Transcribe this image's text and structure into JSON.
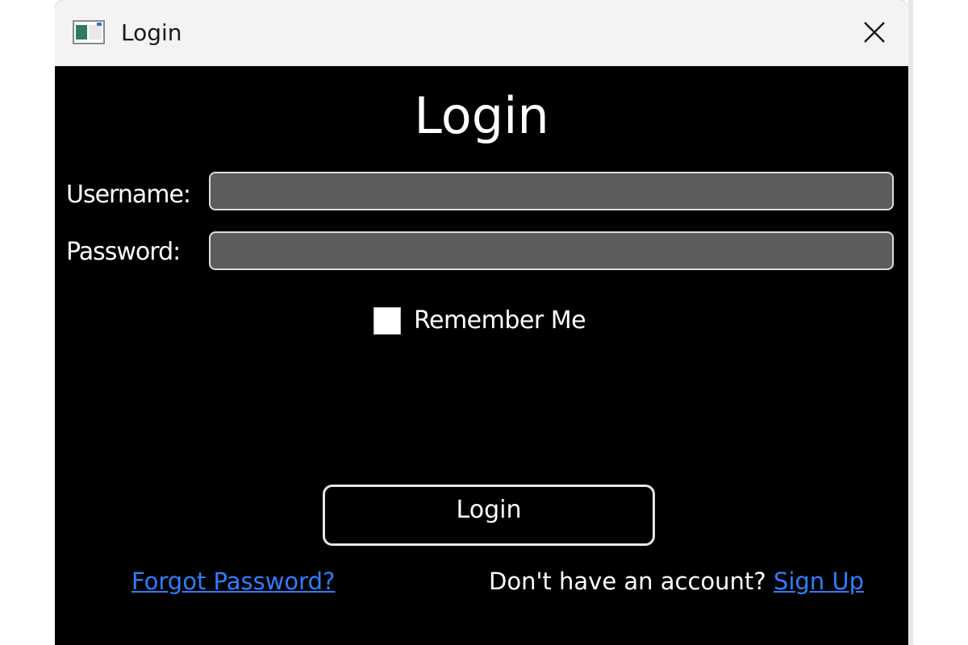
{
  "window": {
    "title": "Login",
    "app_icon": "window-app-icon",
    "close_icon": "close-icon"
  },
  "form": {
    "heading": "Login",
    "username_label": "Username:",
    "username_value": "",
    "password_label": "Password:",
    "password_value": "",
    "remember_label": "Remember Me",
    "remember_checked": false,
    "login_button": "Login"
  },
  "footer": {
    "forgot_link": "Forgot Password?",
    "signup_prompt": "Don't have an account?",
    "signup_link": "Sign Up"
  },
  "colors": {
    "background": "#000000",
    "titlebar": "#f3f3f3",
    "input_fill": "#5c5c5c",
    "link": "#2f7dff"
  }
}
